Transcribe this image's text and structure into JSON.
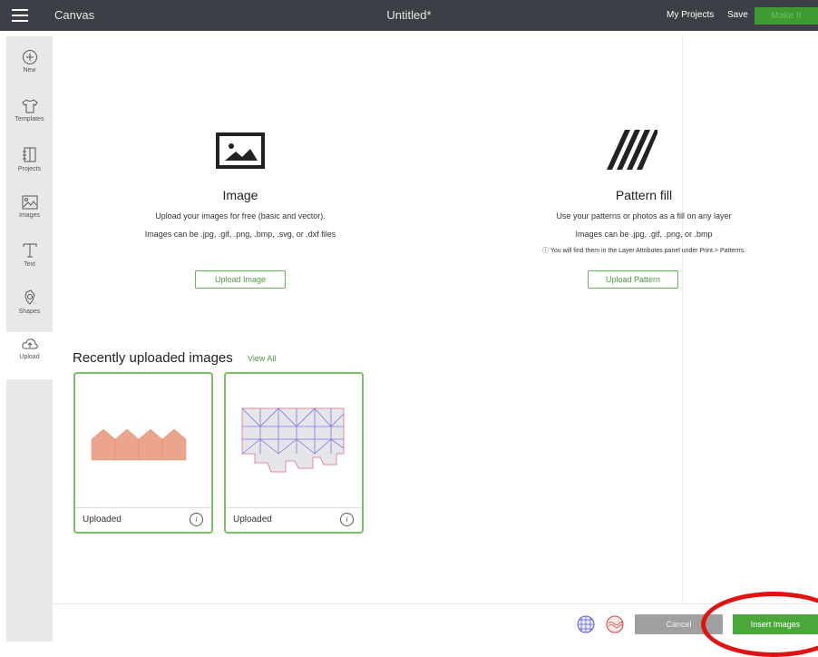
{
  "topbar": {
    "app_title": "Canvas",
    "doc_title": "Untitled*",
    "my_projects": "My Projects",
    "save": "Save",
    "make_it": "Make It"
  },
  "sidebar": {
    "items": [
      {
        "label": "New",
        "icon": "plus-circle-icon"
      },
      {
        "label": "Templates",
        "icon": "tshirt-icon"
      },
      {
        "label": "Projects",
        "icon": "projects-icon"
      },
      {
        "label": "Images",
        "icon": "images-icon"
      },
      {
        "label": "Text",
        "icon": "text-icon"
      },
      {
        "label": "Shapes",
        "icon": "shapes-icon"
      },
      {
        "label": "Upload",
        "icon": "upload-cloud-icon"
      }
    ]
  },
  "image_section": {
    "title": "Image",
    "line1": "Upload your images for free (basic and vector).",
    "line2": "Images can be .jpg, .gif, .png, .bmp, .svg, or .dxf files",
    "button": "Upload Image"
  },
  "pattern_section": {
    "title": "Pattern fill",
    "line1": "Use your patterns or photos as a fill on any layer",
    "line2": "Images can be .jpg, .gif, .png, or .bmp",
    "note": "ⓘ You will find them in the Layer Attributes panel under Print > Patterns.",
    "button": "Upload Pattern"
  },
  "recent": {
    "title": "Recently uploaded images",
    "view_all": "View All",
    "cards": [
      {
        "label": "Uploaded",
        "info": "i"
      },
      {
        "label": "Uploaded",
        "info": "i"
      }
    ]
  },
  "footer": {
    "cancel": "Cancel",
    "insert": "Insert Images"
  },
  "colors": {
    "topbar": "#3c4046",
    "accent_green": "#4aa83a",
    "highlight_red": "#e01212"
  }
}
